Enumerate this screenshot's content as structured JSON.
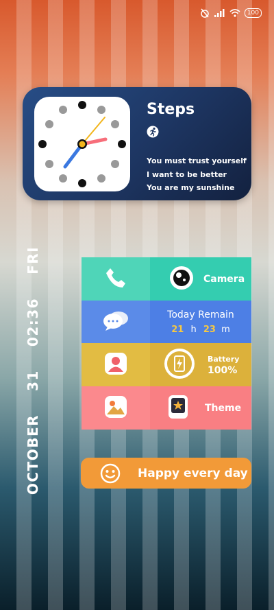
{
  "status_bar": {
    "battery": "100"
  },
  "steps_widget": {
    "title": "Steps",
    "quotes": [
      "You must trust yourself",
      "I want to be better",
      "You are my sunshine"
    ]
  },
  "date": {
    "month": "OCTOBER",
    "day": "31",
    "time": "02:36",
    "weekday": "FRI"
  },
  "grid": {
    "camera_label": "Camera",
    "remain_title": "Today Remain",
    "remain_hours": "21",
    "remain_hours_unit": "h",
    "remain_minutes": "23",
    "remain_minutes_unit": "m",
    "battery_label": "Battery",
    "battery_value": "100%",
    "theme_label": "Theme"
  },
  "happy": {
    "label": "Happy every day"
  },
  "icons": {
    "phone": "phone-icon",
    "camera": "camera-icon",
    "messages": "messages-icon",
    "contacts": "contacts-icon",
    "battery": "battery-icon",
    "gallery": "gallery-icon",
    "theme": "theme-icon",
    "smile": "smile-icon",
    "runner": "runner-icon"
  },
  "colors": {
    "accent_yellow": "#f6c842",
    "steps_bg": "#1d3561",
    "happy_bg": "#f29a38"
  }
}
